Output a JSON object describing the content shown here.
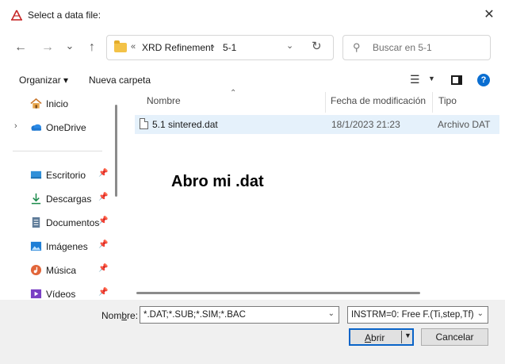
{
  "window": {
    "title": "Select a data file:"
  },
  "nav": {
    "back": "←",
    "forward": "→",
    "recent": "⌄",
    "up": "↑",
    "breadcrumb": [
      "«",
      "XRD Refinement",
      "›",
      "5-1"
    ],
    "search_placeholder": "Buscar en 5-1"
  },
  "toolbar": {
    "organize": "Organizar ▾",
    "new_folder": "Nueva carpeta"
  },
  "sidebar": {
    "items": [
      {
        "label": "Inicio",
        "icon": "home-icon"
      },
      {
        "label": "OneDrive",
        "icon": "cloud-icon"
      },
      {
        "label": "Escritorio",
        "icon": "desktop-icon"
      },
      {
        "label": "Descargas",
        "icon": "download-icon"
      },
      {
        "label": "Documentos",
        "icon": "document-icon"
      },
      {
        "label": "Imágenes",
        "icon": "picture-icon"
      },
      {
        "label": "Música",
        "icon": "music-icon"
      },
      {
        "label": "Vídeos",
        "icon": "video-icon"
      }
    ]
  },
  "columns": {
    "name": "Nombre",
    "date": "Fecha de modificación",
    "type": "Tipo"
  },
  "files": [
    {
      "name": "5.1 sintered.dat",
      "date": "18/1/2023 21:23",
      "type": "Archivo DAT"
    }
  ],
  "annotation": "Abro mi .dat",
  "footer": {
    "filename_label_pre": "Nom",
    "filename_label_u": "b",
    "filename_label_post": "re:",
    "filename_value": "*.DAT;*.SUB;*.SIM;*.BAC",
    "filter_value": "INSTRM=0: Free F.(Ti,step,Tf)",
    "open_u": "A",
    "open_rest": "brir",
    "cancel": "Cancelar"
  },
  "colors": {
    "accent": "#0a64c8",
    "selection": "#e5f1fb",
    "footer_bg": "#f0f0f0"
  }
}
